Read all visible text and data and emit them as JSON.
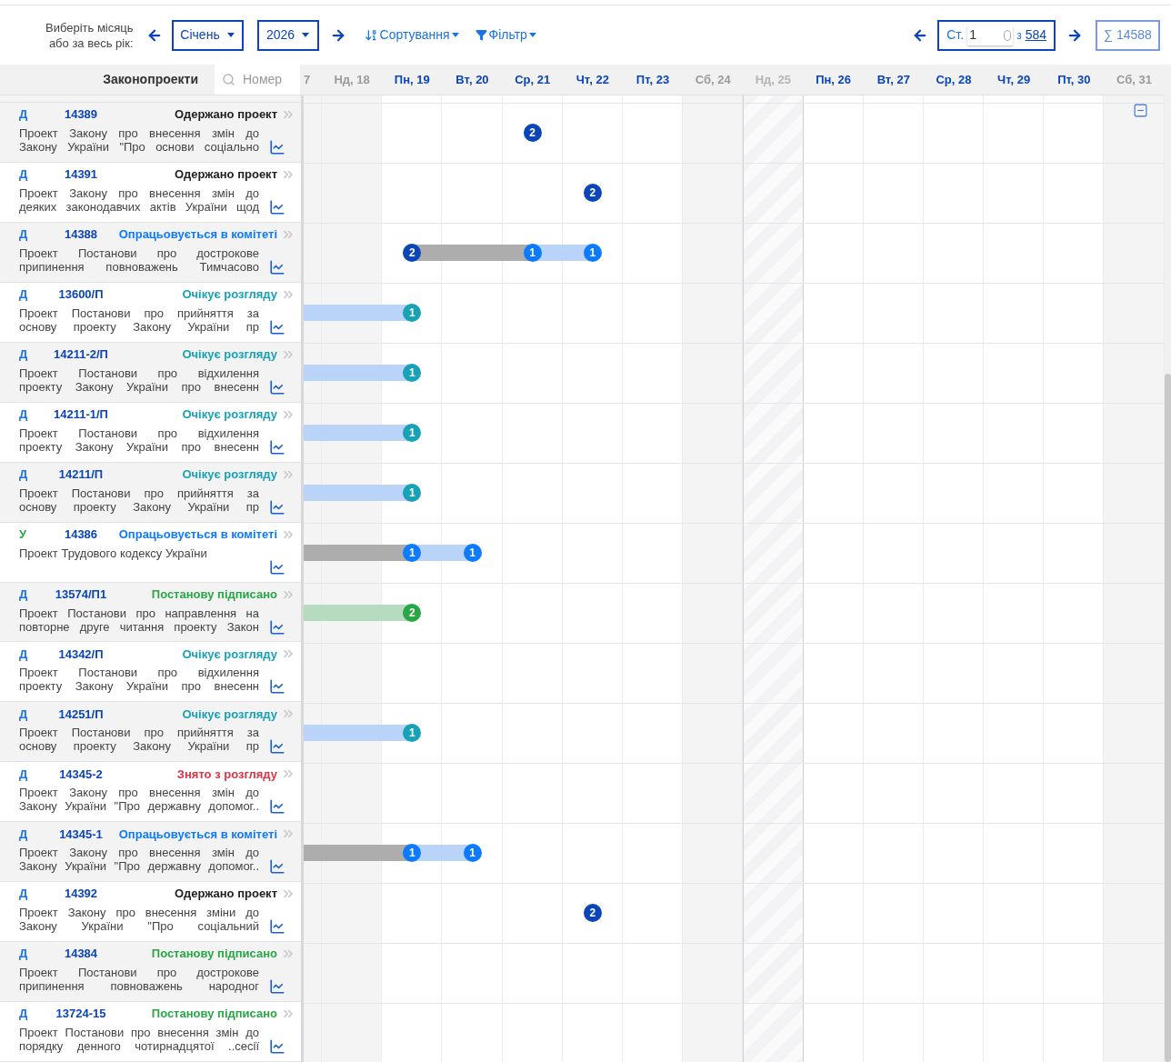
{
  "toolbar": {
    "period_label": [
      "Виберіть місяць",
      "або за весь рік:"
    ],
    "month": "Січень",
    "year": "2026",
    "sort": "Сортування",
    "filter": "Фільтр",
    "page_label": "Ст.",
    "page_value": "1",
    "page_of": "з",
    "page_total": "584",
    "total": "∑ 14588"
  },
  "list_header": {
    "title": "Законопроекти",
    "search_placeholder": "Номер"
  },
  "columns": [
    {
      "label": "7",
      "kind": "weekend"
    },
    {
      "label": "Нд, 18",
      "kind": "weekend"
    },
    {
      "label": "Пн, 19",
      "kind": "weekday"
    },
    {
      "label": "Вт, 20",
      "kind": "weekday"
    },
    {
      "label": "Ср, 21",
      "kind": "weekday"
    },
    {
      "label": "Чт, 22",
      "kind": "weekday"
    },
    {
      "label": "Пт, 23",
      "kind": "weekday"
    },
    {
      "label": "Сб, 24",
      "kind": "weekend"
    },
    {
      "label": "Нд, 25",
      "kind": "holiday"
    },
    {
      "label": "Пн, 26",
      "kind": "weekday"
    },
    {
      "label": "Вт, 27",
      "kind": "weekday"
    },
    {
      "label": "Ср, 28",
      "kind": "weekday"
    },
    {
      "label": "Чт, 29",
      "kind": "weekday"
    },
    {
      "label": "Пт, 30",
      "kind": "weekday"
    },
    {
      "label": "Сб, 31",
      "kind": "weekend"
    }
  ],
  "rows": [
    {
      "type": {
        "label": "Д",
        "color": "#1a73e8"
      },
      "number": "14389",
      "status": {
        "label": "Одержано проект",
        "color": "#222222"
      },
      "description": [
        "Проект Закону про внесення змін до",
        "Закону України \"Про основи соціально"
      ],
      "cells": [
        {},
        {},
        {},
        {},
        {
          "badge": {
            "label": "2",
            "color": "#0b45b8"
          }
        }
      ]
    },
    {
      "type": {
        "label": "Д",
        "color": "#1a73e8"
      },
      "number": "14391",
      "status": {
        "label": "Одержано проект",
        "color": "#222222"
      },
      "description": [
        "Проект Закону про внесення змін до",
        "деяких законодавчих актів України щод"
      ],
      "cells": [
        {},
        {},
        {},
        {},
        {},
        {
          "badge": {
            "label": "2",
            "color": "#0b45b8"
          }
        }
      ]
    },
    {
      "type": {
        "label": "Д",
        "color": "#1a73e8"
      },
      "number": "14388",
      "status": {
        "label": "Опрацьовується в комітеті",
        "color": "#0d7bff"
      },
      "description": [
        "Проект Постанови про дострокове",
        "припинення повноважень Тимчасово"
      ],
      "cells": [
        {},
        {},
        {
          "right": {
            "color": "#adadad"
          },
          "badge": {
            "label": "2",
            "color": "#0b45b8"
          }
        },
        {
          "left": {
            "color": "#adadad"
          },
          "right": {
            "color": "#adadad"
          }
        },
        {
          "left": {
            "color": "#adadad"
          },
          "right": {
            "color": "#bad3f8"
          },
          "badge": {
            "label": "1",
            "color": "#0d7bff"
          }
        },
        {
          "left": {
            "color": "#bad3f8"
          },
          "badge": {
            "label": "1",
            "color": "#0d7bff"
          }
        }
      ]
    },
    {
      "type": {
        "label": "Д",
        "color": "#1a73e8"
      },
      "number": "13600/П",
      "status": {
        "label": "Очікує розгляду",
        "color": "#17a2b8"
      },
      "description": [
        "Проект Постанови про прийняття за",
        "основу проекту Закону України пр"
      ],
      "cells": [
        {
          "left": {
            "color": "#bad3f8"
          },
          "right": {
            "color": "#bad3f8"
          }
        },
        {
          "left": {
            "color": "#bad3f8"
          },
          "right": {
            "color": "#bad3f8"
          }
        },
        {
          "left": {
            "color": "#bad3f8"
          },
          "badge": {
            "label": "1",
            "color": "#17a2b8"
          }
        }
      ]
    },
    {
      "type": {
        "label": "Д",
        "color": "#1a73e8"
      },
      "number": "14211-2/П",
      "status": {
        "label": "Очікує розгляду",
        "color": "#17a2b8"
      },
      "description": [
        "Проект Постанови про відхилення",
        "проекту Закону України про внесенн"
      ],
      "cells": [
        {
          "left": {
            "color": "#bad3f8"
          },
          "right": {
            "color": "#bad3f8"
          }
        },
        {
          "left": {
            "color": "#bad3f8"
          },
          "right": {
            "color": "#bad3f8"
          }
        },
        {
          "left": {
            "color": "#bad3f8"
          },
          "badge": {
            "label": "1",
            "color": "#17a2b8"
          }
        }
      ]
    },
    {
      "type": {
        "label": "Д",
        "color": "#1a73e8"
      },
      "number": "14211-1/П",
      "status": {
        "label": "Очікує розгляду",
        "color": "#17a2b8"
      },
      "description": [
        "Проект Постанови про відхилення",
        "проекту Закону України про внесенн"
      ],
      "cells": [
        {
          "left": {
            "color": "#bad3f8"
          },
          "right": {
            "color": "#bad3f8"
          }
        },
        {
          "left": {
            "color": "#bad3f8"
          },
          "right": {
            "color": "#bad3f8"
          }
        },
        {
          "left": {
            "color": "#bad3f8"
          },
          "badge": {
            "label": "1",
            "color": "#17a2b8"
          }
        }
      ]
    },
    {
      "type": {
        "label": "Д",
        "color": "#1a73e8"
      },
      "number": "14211/П",
      "status": {
        "label": "Очікує розгляду",
        "color": "#17a2b8"
      },
      "description": [
        "Проект Постанови про прийняття за",
        "основу проекту Закону України пр"
      ],
      "cells": [
        {
          "left": {
            "color": "#bad3f8"
          },
          "right": {
            "color": "#bad3f8"
          }
        },
        {
          "left": {
            "color": "#bad3f8"
          },
          "right": {
            "color": "#bad3f8"
          }
        },
        {
          "left": {
            "color": "#bad3f8"
          },
          "badge": {
            "label": "1",
            "color": "#17a2b8"
          }
        }
      ]
    },
    {
      "type": {
        "label": "У",
        "color": "#28a745"
      },
      "number": "14386",
      "status": {
        "label": "Опрацьовується в комітеті",
        "color": "#0d7bff"
      },
      "description": [
        "Проект Трудового кодексу України"
      ],
      "cells": [
        {
          "left": {
            "color": "#adadad"
          },
          "right": {
            "color": "#adadad"
          }
        },
        {
          "left": {
            "color": "#adadad"
          },
          "right": {
            "color": "#adadad"
          }
        },
        {
          "left": {
            "color": "#adadad"
          },
          "right": {
            "color": "#bad3f8"
          },
          "badge": {
            "label": "1",
            "color": "#0d7bff"
          }
        },
        {
          "left": {
            "color": "#bad3f8"
          },
          "badge": {
            "label": "1",
            "color": "#0d7bff"
          }
        }
      ]
    },
    {
      "type": {
        "label": "Д",
        "color": "#1a73e8"
      },
      "number": "13574/П1",
      "status": {
        "label": "Постанову підписано",
        "color": "#28a745"
      },
      "description": [
        "Проект Постанови про направлення на",
        "повторне друге читання проекту Закон"
      ],
      "cells": [
        {
          "left": {
            "color": "#b6dcbf"
          },
          "right": {
            "color": "#b6dcbf"
          }
        },
        {
          "left": {
            "color": "#b6dcbf"
          },
          "right": {
            "color": "#b6dcbf"
          }
        },
        {
          "left": {
            "color": "#b6dcbf"
          },
          "badge": {
            "label": "2",
            "color": "#28a745"
          }
        }
      ]
    },
    {
      "type": {
        "label": "Д",
        "color": "#1a73e8"
      },
      "number": "14342/П",
      "status": {
        "label": "Очікує розгляду",
        "color": "#17a2b8"
      },
      "description": [
        "Проект Постанови про відхилення",
        "проекту Закону України про внесенн"
      ]
    },
    {
      "type": {
        "label": "Д",
        "color": "#1a73e8"
      },
      "number": "14251/П",
      "status": {
        "label": "Очікує розгляду",
        "color": "#17a2b8"
      },
      "description": [
        "Проект Постанови про прийняття за",
        "основу проекту Закону України пр"
      ],
      "cells": [
        {
          "left": {
            "color": "#bad3f8"
          },
          "right": {
            "color": "#bad3f8"
          }
        },
        {
          "left": {
            "color": "#bad3f8"
          },
          "right": {
            "color": "#bad3f8"
          }
        },
        {
          "left": {
            "color": "#bad3f8"
          },
          "badge": {
            "label": "1",
            "color": "#17a2b8"
          }
        }
      ]
    },
    {
      "type": {
        "label": "Д",
        "color": "#1a73e8"
      },
      "number": "14345-2",
      "status": {
        "label": "Знято з розгляду",
        "color": "#dc3545"
      },
      "description": [
        "Проект Закону про внесення змін до",
        "Закону України \"Про державну допомог.."
      ]
    },
    {
      "type": {
        "label": "Д",
        "color": "#1a73e8"
      },
      "number": "14345-1",
      "status": {
        "label": "Опрацьовується в комітеті",
        "color": "#0d7bff"
      },
      "description": [
        "Проект Закону про внесення змін до",
        "Закону України \"Про державну допомог.."
      ],
      "cells": [
        {
          "left": {
            "color": "#adadad"
          },
          "right": {
            "color": "#adadad"
          }
        },
        {
          "left": {
            "color": "#adadad"
          },
          "right": {
            "color": "#adadad"
          }
        },
        {
          "left": {
            "color": "#adadad"
          },
          "right": {
            "color": "#bad3f8"
          },
          "badge": {
            "label": "1",
            "color": "#0d7bff"
          }
        },
        {
          "left": {
            "color": "#bad3f8"
          },
          "badge": {
            "label": "1",
            "color": "#0d7bff"
          }
        }
      ]
    },
    {
      "type": {
        "label": "Д",
        "color": "#1a73e8"
      },
      "number": "14392",
      "status": {
        "label": "Одержано проект",
        "color": "#222222"
      },
      "description": [
        "Проект Закону про внесення зміни до",
        "Закону України \"Про соціальний"
      ],
      "cells": [
        {},
        {},
        {},
        {},
        {},
        {
          "badge": {
            "label": "2",
            "color": "#0b45b8"
          }
        }
      ]
    },
    {
      "type": {
        "label": "Д",
        "color": "#1a73e8"
      },
      "number": "14384",
      "status": {
        "label": "Постанову підписано",
        "color": "#28a745"
      },
      "description": [
        "Проект Постанови про дострокове",
        "припинення повноважень народног"
      ]
    },
    {
      "type": {
        "label": "Д",
        "color": "#1a73e8"
      },
      "number": "13724-15",
      "status": {
        "label": "Постанову підписано",
        "color": "#28a745"
      },
      "description": [
        "Проект Постанови про внесення змін до",
        "порядку денного чотирнадцятої ..сесії"
      ]
    }
  ]
}
